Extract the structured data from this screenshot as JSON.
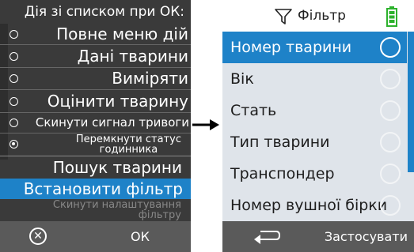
{
  "left_screen": {
    "header": "Дія зі списком при ОК:",
    "options": [
      {
        "label": "Повне меню дій",
        "selected": false
      },
      {
        "label": "Дані тварини",
        "selected": false
      },
      {
        "label": "Виміряти",
        "selected": false
      },
      {
        "label": "Оцінити тварину",
        "selected": false
      },
      {
        "label": "Скинути сигнал тривоги",
        "selected": false
      },
      {
        "label_line1": "Перемкнути статус",
        "label_line2": "годинника",
        "selected": true
      }
    ],
    "search_label": "Пошук тварини",
    "filter_label": "Встановити фільтр",
    "reset_line1": "Скинути налаштування",
    "reset_line2": "фільтру",
    "footer": {
      "ok_label": "ОК",
      "cancel_icon": "cancel-circle-icon"
    }
  },
  "right_screen": {
    "title": "Фільтр",
    "title_icon": "filter-funnel-icon",
    "battery_icon": "battery-icon",
    "items": [
      {
        "label": "Номер тварини",
        "selected": true
      },
      {
        "label": "Вік",
        "selected": false
      },
      {
        "label": "Стать",
        "selected": false
      },
      {
        "label": "Тип тварини",
        "selected": false
      },
      {
        "label": "Транспондер",
        "selected": false
      },
      {
        "label": "Номер вушної бірки",
        "selected": false
      }
    ],
    "footer": {
      "back_icon": "back-arrow-icon",
      "apply_label": "Застосувати"
    }
  },
  "colors": {
    "accent": "#1e82c8",
    "dark_bg": "#3a3a3a",
    "footer_bg": "#5a5a5a",
    "list_bg": "#dfe4ea",
    "battery": "#2db22d"
  }
}
